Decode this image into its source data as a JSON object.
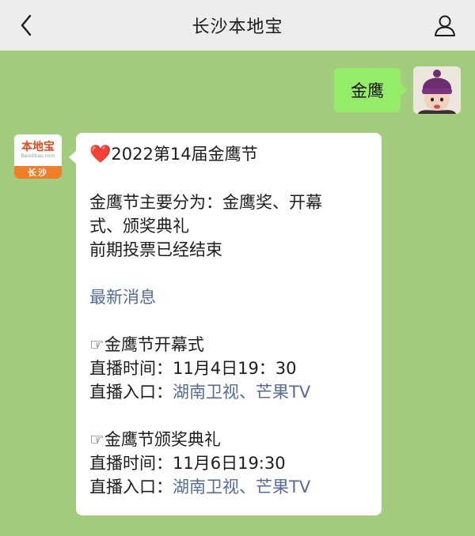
{
  "header": {
    "title": "长沙本地宝",
    "back_icon": "chevron-left-icon",
    "user_icon": "person-icon"
  },
  "outgoing": {
    "text": "金鹰",
    "bubble_color": "#95ec69"
  },
  "bot_avatar": {
    "main": "本地宝",
    "sub": "Bendibao.com",
    "city": "长沙"
  },
  "message": {
    "heart": "❤️",
    "headline": "2022第14届金鹰节",
    "intro_1": "金鹰节主要分为：金鹰奖、开幕",
    "intro_2": "式、颁奖典礼",
    "intro_3": "前期投票已经结束",
    "latest_news": "最新消息",
    "pointer": "☞",
    "event1_title": "金鹰节开幕式",
    "event1_time": "直播时间：11月4日19：30",
    "event1_entry_label": "直播入口：",
    "event1_link1": "湖南卫视",
    "event1_sep": "、",
    "event1_link2": "芒果TV",
    "event2_title": "金鹰节颁奖典礼",
    "event2_time": "直播时间：11月6日19:30",
    "event2_entry_label": "直播入口：",
    "event2_link1": "湖南卫视",
    "event2_sep": "、",
    "event2_link2": "芒果TV"
  },
  "colors": {
    "chat_background": "#a4cc7e",
    "link": "#576b95",
    "topbar": "#ededed"
  }
}
